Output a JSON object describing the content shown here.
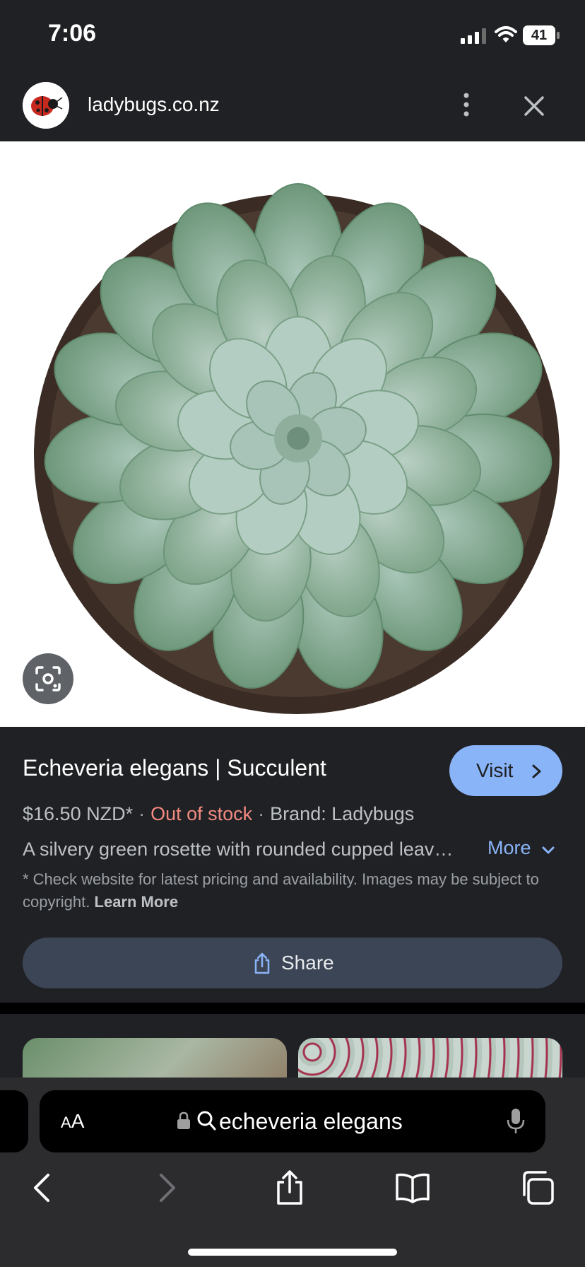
{
  "status_bar": {
    "time": "7:06",
    "battery": "41"
  },
  "site": {
    "domain": "ladybugs.co.nz",
    "favicon": "ladybug-logo"
  },
  "product": {
    "title": "Echeveria elegans | Succulent",
    "visit_label": "Visit",
    "price": "$16.50 NZD*",
    "stock": "Out of stock",
    "brand": "Brand: Ladybugs",
    "separator": "·",
    "description": "A silvery green rosette with rounded cupped leav…",
    "more_label": "More",
    "disclaimer": "* Check website for latest pricing and availability. Images may be subject to copyright.",
    "learn_more": "Learn More",
    "share_label": "Share"
  },
  "browser": {
    "aa_label_big": "A",
    "aa_label_small": "A",
    "address": "echeveria elegans"
  },
  "colors": {
    "background": "#202124",
    "accent": "#8ab4f8",
    "stock_red": "#f28b82",
    "share_button": "#3c4556",
    "toolbar": "#2c2c2e"
  }
}
